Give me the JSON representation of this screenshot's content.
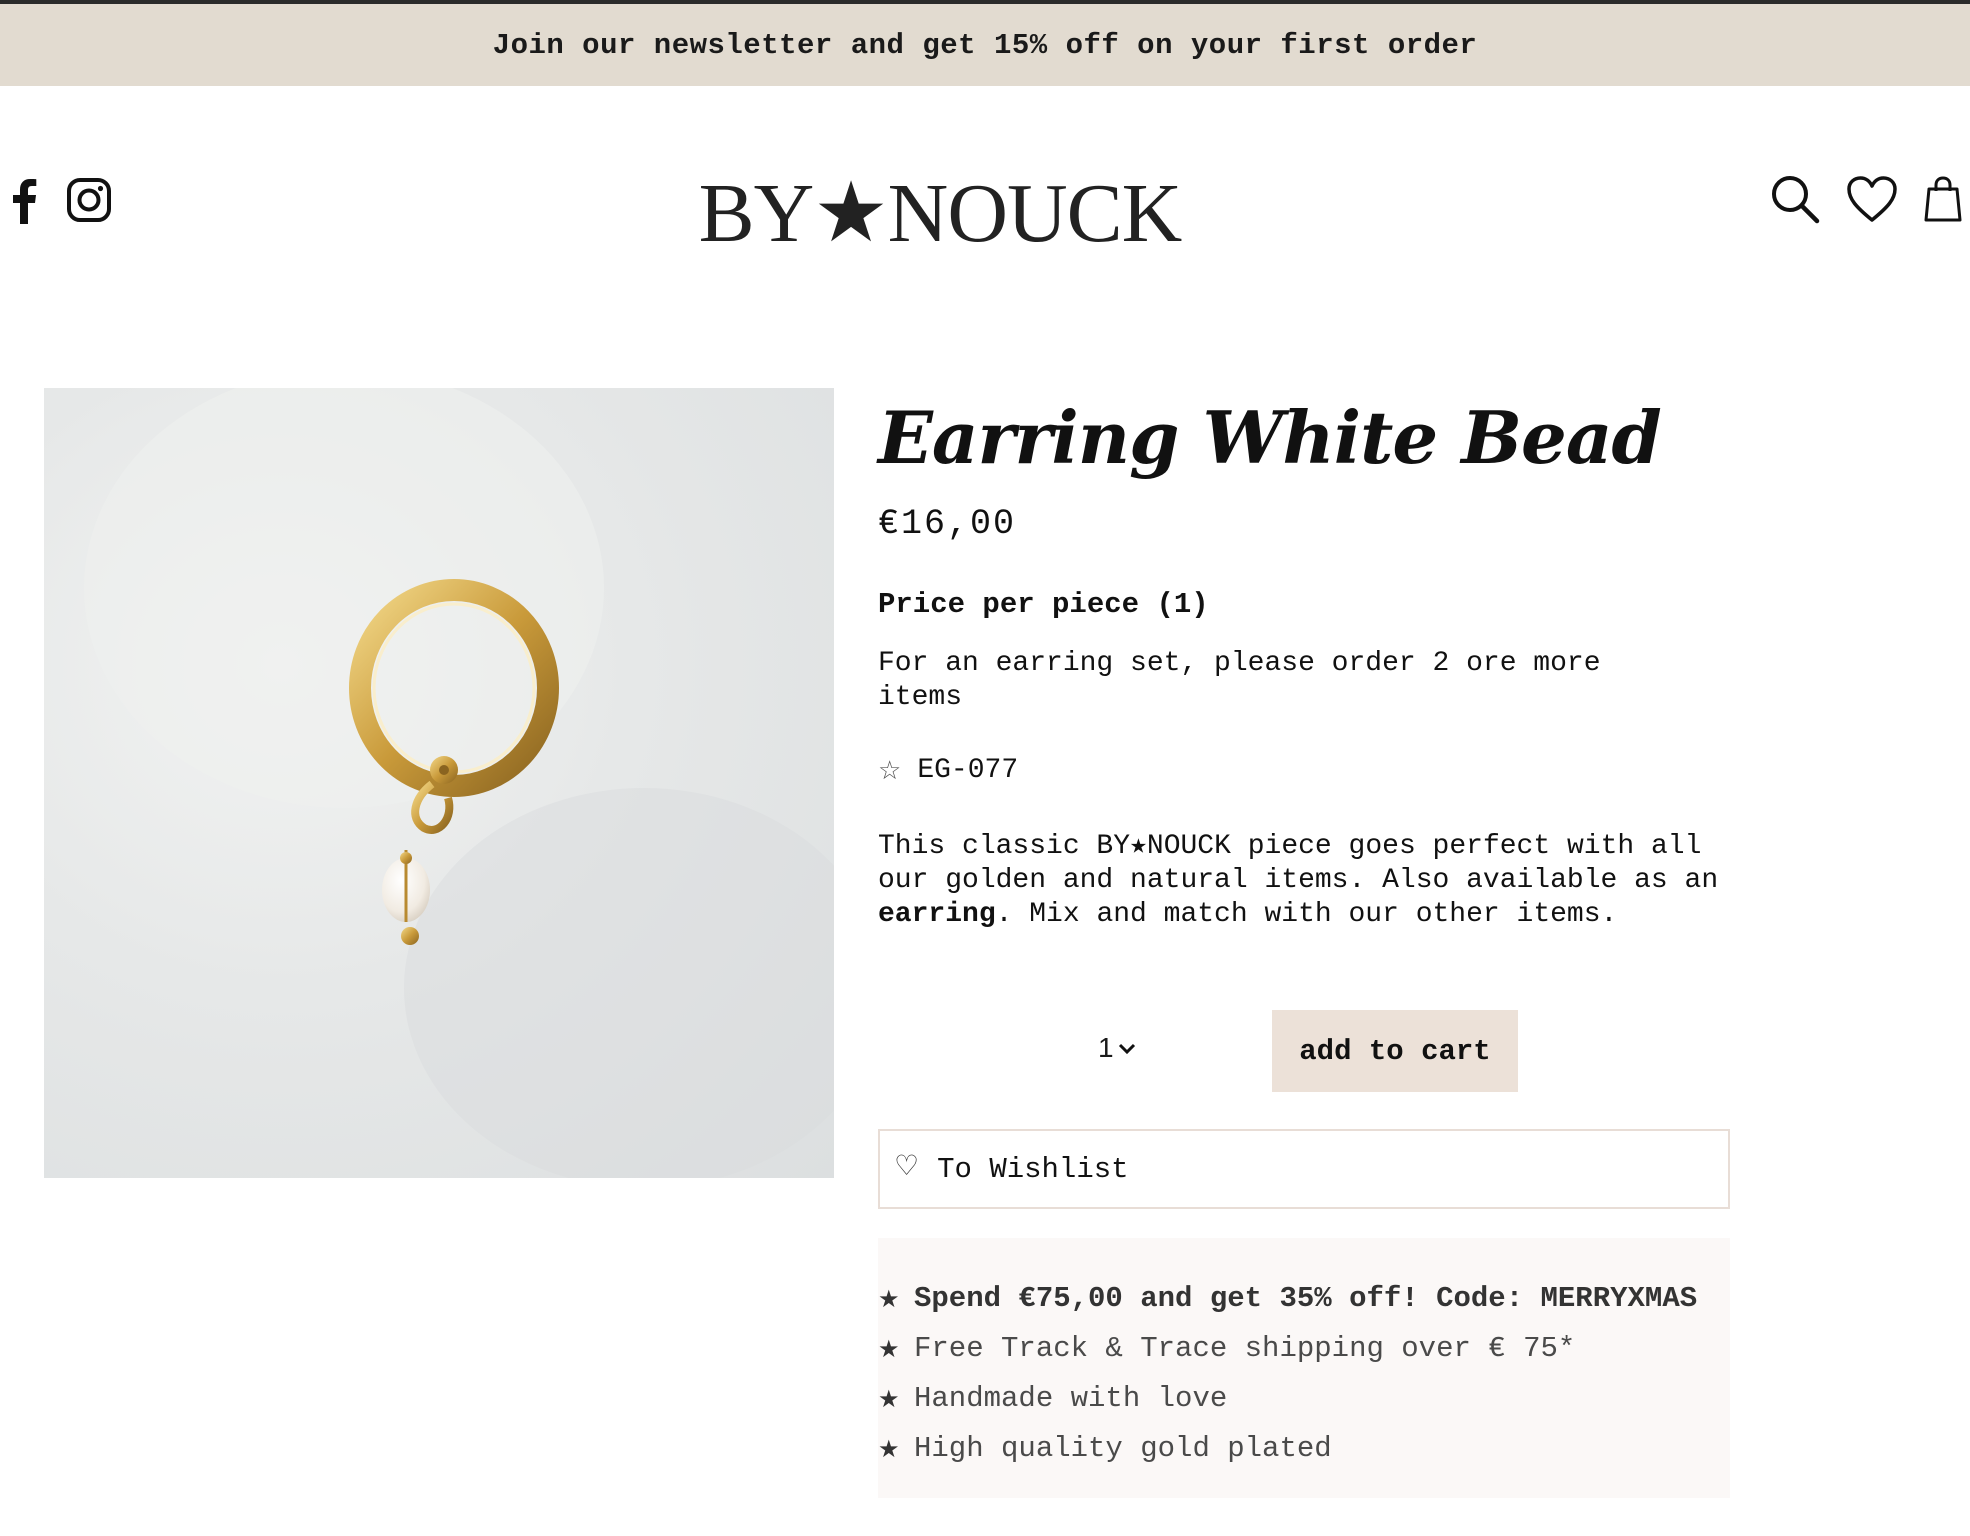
{
  "announcement": {
    "text": "Join our newsletter and get 15% off on your first order"
  },
  "header": {
    "logo": "BY★NOUCK",
    "social": [
      "facebook-icon",
      "instagram-icon"
    ],
    "actions": [
      "search-icon",
      "heart-icon",
      "shopping-bag-icon"
    ]
  },
  "product": {
    "title": "Earring White Bead",
    "price": "€16,00",
    "price_per_piece": "Price per piece (1)",
    "set_note": "For an earring set, please order 2 ore more items",
    "sku_star": "☆",
    "sku": "EG-077",
    "description_1": "This classic BY★NOUCK piece goes perfect with all our golden and natural items. Also available as an ",
    "description_bold": "earring",
    "description_2": ". Mix and match with our other items."
  },
  "cart": {
    "quantity": "1",
    "add_to_cart": "add to cart",
    "wishlist_icon": "♡",
    "wishlist_label": "To Wishlist"
  },
  "perks": {
    "star": "★",
    "items": [
      "Spend €75,00 and get 35% off! Code: MERRYXMAS",
      "Free Track & Trace shipping over € 75*",
      "Handmade with love",
      "High quality gold plated"
    ]
  },
  "colors": {
    "announcement_bg": "#e2dbd0",
    "add_to_cart_bg": "#ece1d8",
    "perks_bg": "#fbf8f7",
    "wishlist_border": "#e8ddd6"
  }
}
